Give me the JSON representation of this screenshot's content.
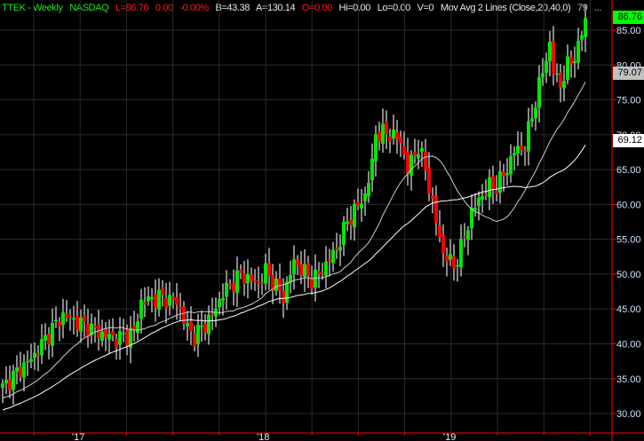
{
  "header": {
    "symbol": "TTEK - Weekly",
    "exchange": "NASDAQ",
    "last": "L=86.76",
    "change": "0.00",
    "change_pct": "-0.00%",
    "bid": "B=43.38",
    "ask": "A=130.14",
    "open": "O=0.00",
    "high": "Hi=0.00",
    "low": "Lo=0.00",
    "volume": "V=0",
    "study": "Mov Avg 2 Lines (Close,20,40,0)",
    "study_value": "79",
    "more": "..."
  },
  "colors": {
    "up": "#00e600",
    "down": "#ff0000",
    "wick": "#888888",
    "axis": "#ff0000",
    "grid": "#2a2a2a",
    "ma20": "#cccccc",
    "ma40": "#ffffff"
  },
  "chart_data": {
    "type": "candlestick",
    "title": "TTEK - Weekly NASDAQ",
    "ylim": [
      28,
      88
    ],
    "yticks": [
      "30.00",
      "35.00",
      "40.00",
      "45.00",
      "50.00",
      "55.00",
      "60.00",
      "65.00",
      "70.00",
      "75.00",
      "80.00",
      "85.00"
    ],
    "xticks": [
      {
        "label": "'17",
        "week": 21.5
      },
      {
        "label": "'18",
        "week": 73.5
      },
      {
        "label": "'19",
        "week": 126
      }
    ],
    "close_keypoints": [
      [
        0,
        33.7
      ],
      [
        4,
        35.9
      ],
      [
        9,
        38.4
      ],
      [
        14,
        42.2
      ],
      [
        17,
        44.1
      ],
      [
        22,
        42.9
      ],
      [
        27,
        41.6
      ],
      [
        32,
        40.7
      ],
      [
        37,
        41.6
      ],
      [
        39,
        46.0
      ],
      [
        44,
        46.7
      ],
      [
        49,
        46.0
      ],
      [
        52,
        42.2
      ],
      [
        54,
        41.0
      ],
      [
        59,
        44.1
      ],
      [
        62,
        47.3
      ],
      [
        67,
        49.9
      ],
      [
        72,
        48.6
      ],
      [
        74,
        50.5
      ],
      [
        79,
        46.7
      ],
      [
        82,
        51.8
      ],
      [
        87,
        49.2
      ],
      [
        89,
        49.9
      ],
      [
        94,
        53.7
      ],
      [
        97,
        57.5
      ],
      [
        102,
        61.3
      ],
      [
        104,
        65.8
      ],
      [
        105,
        70.2
      ],
      [
        109,
        70.2
      ],
      [
        112,
        69.0
      ],
      [
        114,
        65.1
      ],
      [
        117,
        68.3
      ],
      [
        119,
        65.1
      ],
      [
        122,
        57.5
      ],
      [
        124,
        53.0
      ],
      [
        127,
        51.1
      ],
      [
        129,
        53.7
      ],
      [
        132,
        58.8
      ],
      [
        134,
        60.7
      ],
      [
        137,
        62.6
      ],
      [
        139,
        62.6
      ],
      [
        142,
        65.1
      ],
      [
        144,
        67.7
      ],
      [
        147,
        68.3
      ],
      [
        149,
        72.8
      ],
      [
        152,
        79.1
      ],
      [
        154,
        83.0
      ],
      [
        155,
        79.0
      ],
      [
        157,
        77.2
      ],
      [
        159,
        79.8
      ],
      [
        162,
        82.3
      ],
      [
        164,
        86.76
      ]
    ],
    "series": [
      {
        "name": "MA 20",
        "last": "79.07"
      },
      {
        "name": "MA 40",
        "last": "69.12"
      }
    ],
    "last_price": "86.76"
  }
}
